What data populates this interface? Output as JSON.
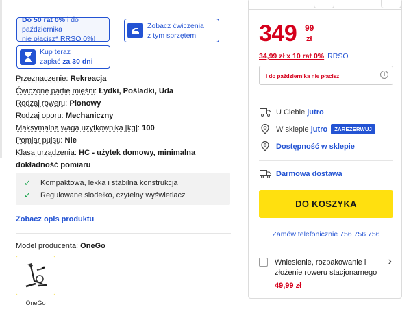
{
  "promos": {
    "rat_bold_1": "Do 50 rat 0%",
    "rat_text_1": " i do października",
    "rat_text_2": "nie płacisz* RRSO 0%!",
    "exercises_line1": "Zobacz ćwiczenia",
    "exercises_line2": "z tym sprzętem",
    "pay_line1": "Kup teraz",
    "pay_line2_prefix": "zapłać ",
    "pay_line2_bold": "za 30 dni"
  },
  "specs": [
    {
      "key": "Przeznaczenie",
      "value": "Rekreacja"
    },
    {
      "key": "Ćwiczone partie mięśni",
      "value": "Łydki, Pośladki, Uda"
    },
    {
      "key": "Rodzaj roweru",
      "value": "Pionowy"
    },
    {
      "key": "Rodzaj oporu",
      "value": "Mechaniczny"
    },
    {
      "key": "Maksymalna waga użytkownika [kg]",
      "value": "100"
    },
    {
      "key": "Pomiar pulsu",
      "value": "Nie"
    },
    {
      "key": "Klasa urządzenia",
      "value": "HC - użytek domowy, minimalna dokładność pomiaru"
    }
  ],
  "features": [
    "Kompaktowa, lekka i stabilna konstrukcja",
    "Regulowane siodełko, czytelny wyświetlacz"
  ],
  "links": {
    "description": "Zobacz opis produktu"
  },
  "model": {
    "label": "Model producenta: ",
    "value": "OneGo",
    "thumb_caption": "OneGo"
  },
  "offer": {
    "price_int": "349",
    "price_dec": "99",
    "currency": "zł",
    "installment_text": "34,99 zł x 10 rat 0%",
    "rrso": "RRSO",
    "info_text": "i do października nie płacisz",
    "info_icon": "i"
  },
  "delivery": {
    "home_label": "U Ciebie ",
    "home_value": "jutro",
    "store_label": "W sklepie ",
    "store_value": "jutro",
    "reserve_button": "ZAREZERWUJ",
    "availability": "Dostępność w sklepie",
    "free_delivery": "Darmowa dostawa"
  },
  "cart_button": "DO KOSZYKA",
  "phone_order": "Zamów telefonicznie 756 756 756",
  "service": {
    "text": "Wniesienie, rozpakowanie i złożenie roweru stacjonarnego",
    "price": "49,99 zł"
  },
  "colors": {
    "accent_blue": "#2353d3",
    "price_red": "#d5001c",
    "cta_yellow": "#ffe00f"
  },
  "icons": [
    "dumbbell-icon",
    "hourglass-icon",
    "check-icon",
    "truck-icon",
    "location-pin-icon",
    "info-icon",
    "chevron-right-icon"
  ]
}
